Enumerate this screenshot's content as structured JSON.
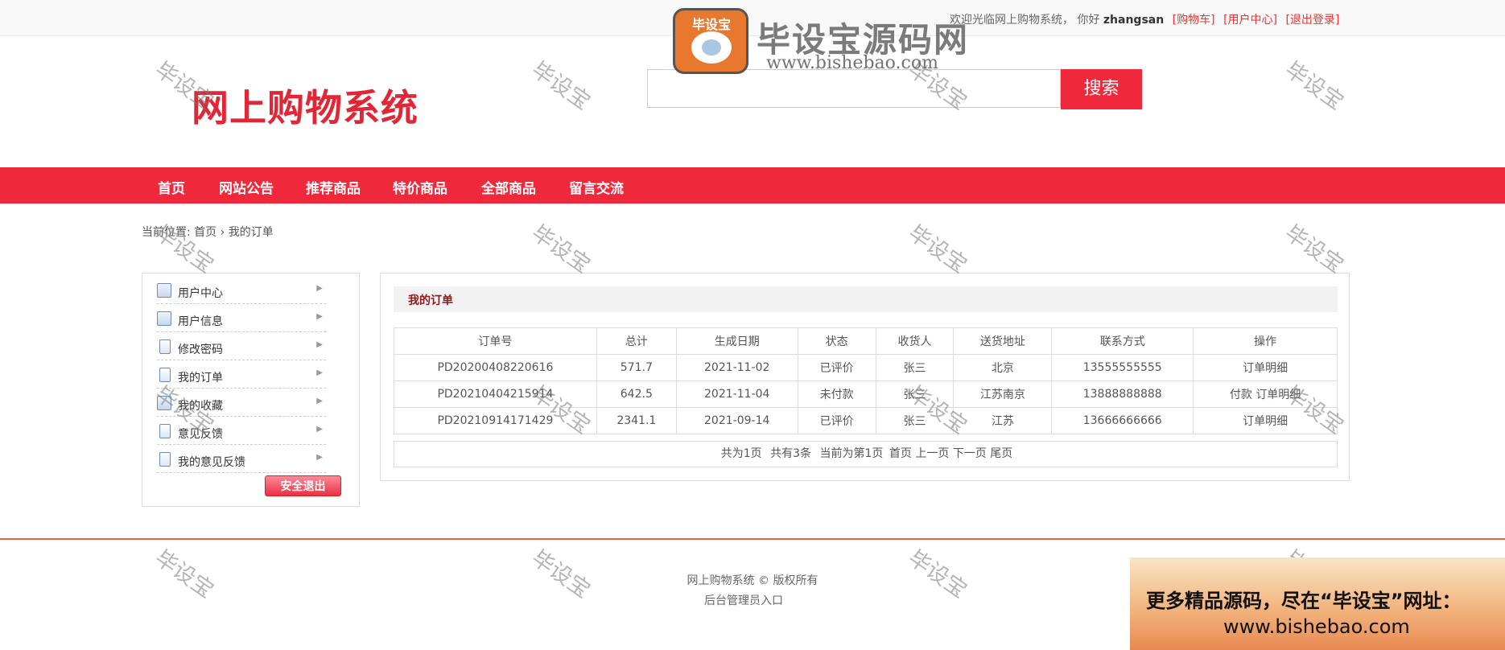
{
  "topbar": {
    "welcome": "欢迎光临网上购物系统，",
    "greeting": "你好",
    "username": "zhangsan",
    "cart": "[购物车]",
    "user_center": "[用户中心]",
    "logout": "[退出登录]"
  },
  "header": {
    "logo": "网上购物系统",
    "search_placeholder": "",
    "search_button": "搜索"
  },
  "nav": [
    "首页",
    "网站公告",
    "推荐商品",
    "特价商品",
    "全部商品",
    "留言交流"
  ],
  "breadcrumb": {
    "prefix": "当前位置:",
    "home": "首页",
    "sep": "›",
    "current": "我的订单"
  },
  "sidebar": {
    "items": [
      {
        "label": "用户中心",
        "icon": "user-card-icon"
      },
      {
        "label": "用户信息",
        "icon": "user-card-icon"
      },
      {
        "label": "修改密码",
        "icon": "document-icon"
      },
      {
        "label": "我的订单",
        "icon": "document-icon"
      },
      {
        "label": "我的收藏",
        "icon": "user-card-icon"
      },
      {
        "label": "意见反馈",
        "icon": "document-icon"
      },
      {
        "label": "我的意见反馈",
        "icon": "document-icon"
      }
    ],
    "logout_button": "安全退出"
  },
  "orders": {
    "title": "我的订单",
    "columns": [
      "订单号",
      "总计",
      "生成日期",
      "状态",
      "收货人",
      "送货地址",
      "联系方式",
      "操作"
    ],
    "rows": [
      {
        "id": "PD20200408220616",
        "total": "571.7",
        "date": "2021-11-02",
        "status": "已评价",
        "receiver": "张三",
        "address": "北京",
        "phone": "13555555555",
        "actions": [
          "订单明细"
        ]
      },
      {
        "id": "PD20210404215914",
        "total": "642.5",
        "date": "2021-11-04",
        "status": "未付款",
        "receiver": "张三",
        "address": "江苏南京",
        "phone": "13888888888",
        "actions": [
          "付款",
          "订单明细"
        ]
      },
      {
        "id": "PD20210914171429",
        "total": "2341.1",
        "date": "2021-09-14",
        "status": "已评价",
        "receiver": "张三",
        "address": "江苏",
        "phone": "13666666666",
        "actions": [
          "订单明细"
        ]
      }
    ]
  },
  "pager": {
    "pages": "共为1页",
    "count": "共有3条",
    "current": "当前为第1页",
    "first": "首页",
    "prev": "上一页",
    "next": "下一页",
    "last": "尾页"
  },
  "footer": {
    "copyright": "网上购物系统 © 版权所有",
    "admin": "后台管理员入口"
  },
  "watermark": {
    "text": "毕设宝",
    "brand_logo_text": "毕设宝",
    "brand_name": "毕设宝源码网",
    "brand_url": "www.bishebao.com",
    "promo_line1": "更多精品源码，尽在“毕设宝”网址：",
    "promo_line2": "www.bishebao.com"
  },
  "colors": {
    "accent": "#f0283c",
    "logo": "#e32636",
    "link": "#ee3333",
    "footer_line": "#e0682f"
  }
}
